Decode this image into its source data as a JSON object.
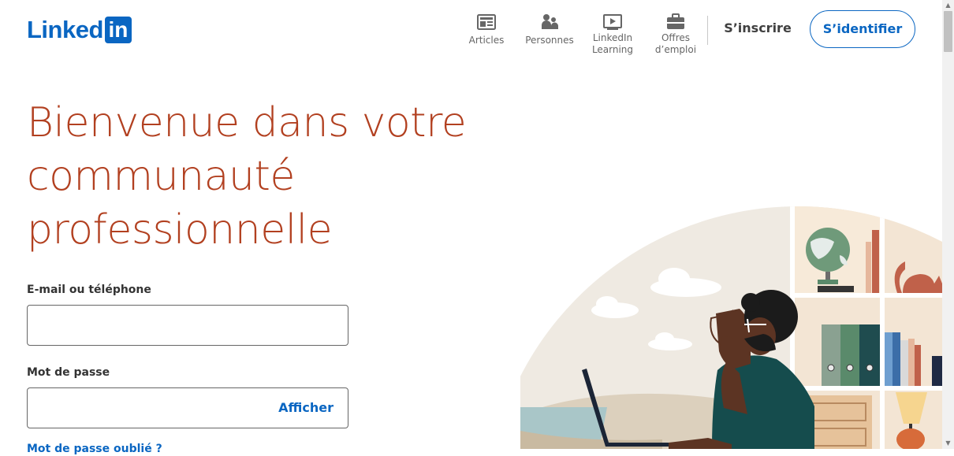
{
  "brand": {
    "logo_text": "Linked",
    "logo_box": "in",
    "color": "#0a66c2"
  },
  "nav": {
    "items": [
      {
        "label": "Articles",
        "icon": "articles-icon"
      },
      {
        "label": "Personnes",
        "icon": "people-icon"
      },
      {
        "label": "LinkedIn Learning",
        "icon": "learning-icon"
      },
      {
        "label": "Offres d’emploi",
        "icon": "jobs-icon"
      }
    ],
    "join_label": "S’inscrire",
    "signin_label": "S’identifier"
  },
  "hero": {
    "headline_lines": [
      "Bienvenue dans votre",
      "communauté",
      "professionnelle"
    ],
    "headline_color": "#b24020"
  },
  "form": {
    "email_label": "E-mail ou téléphone",
    "email_value": "",
    "password_label": "Mot de passe",
    "password_value": "",
    "show_label": "Afficher",
    "forgot_label": "Mot de passe oublié ?"
  }
}
